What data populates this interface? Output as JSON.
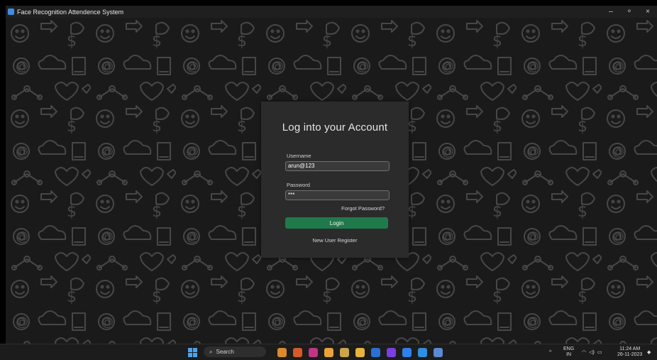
{
  "window": {
    "title": "Face Recognition Attendence System",
    "controls": {
      "minimize": "–",
      "maximize": "⚬",
      "close": "×"
    }
  },
  "login": {
    "heading": "Log into your Account",
    "username_label": "Username",
    "username_value": "arun@123",
    "password_label": "Password",
    "password_value": "***",
    "forgot_label": "Forgot Password?",
    "login_button": "Login",
    "register_link": "New User Register"
  },
  "taskbar": {
    "search_placeholder": "Search",
    "language_top": "ENG",
    "language_bottom": "IN",
    "time": "11:24 AM",
    "date": "26-11-2023",
    "apps": [
      {
        "name": "widgets-icon",
        "color": "#d98a2b"
      },
      {
        "name": "teams-icon",
        "color": "#d45a2a"
      },
      {
        "name": "instagram-icon",
        "color": "#c13584"
      },
      {
        "name": "chrome-icon",
        "color": "#e8a23a"
      },
      {
        "name": "terminal-icon",
        "color": "#caa54a"
      },
      {
        "name": "folder-icon",
        "color": "#e8b53a"
      },
      {
        "name": "word-icon",
        "color": "#2b6fd4"
      },
      {
        "name": "discord-icon",
        "color": "#7a3fe0"
      },
      {
        "name": "notepad-icon",
        "color": "#2f80ed"
      },
      {
        "name": "vscode-icon",
        "color": "#2f8fe0"
      },
      {
        "name": "python-app-icon",
        "color": "#5a8ad4"
      }
    ]
  },
  "colors": {
    "panel": "#2b2b2b",
    "login_button": "#1f7a4b",
    "background": "#1a1a1a"
  }
}
